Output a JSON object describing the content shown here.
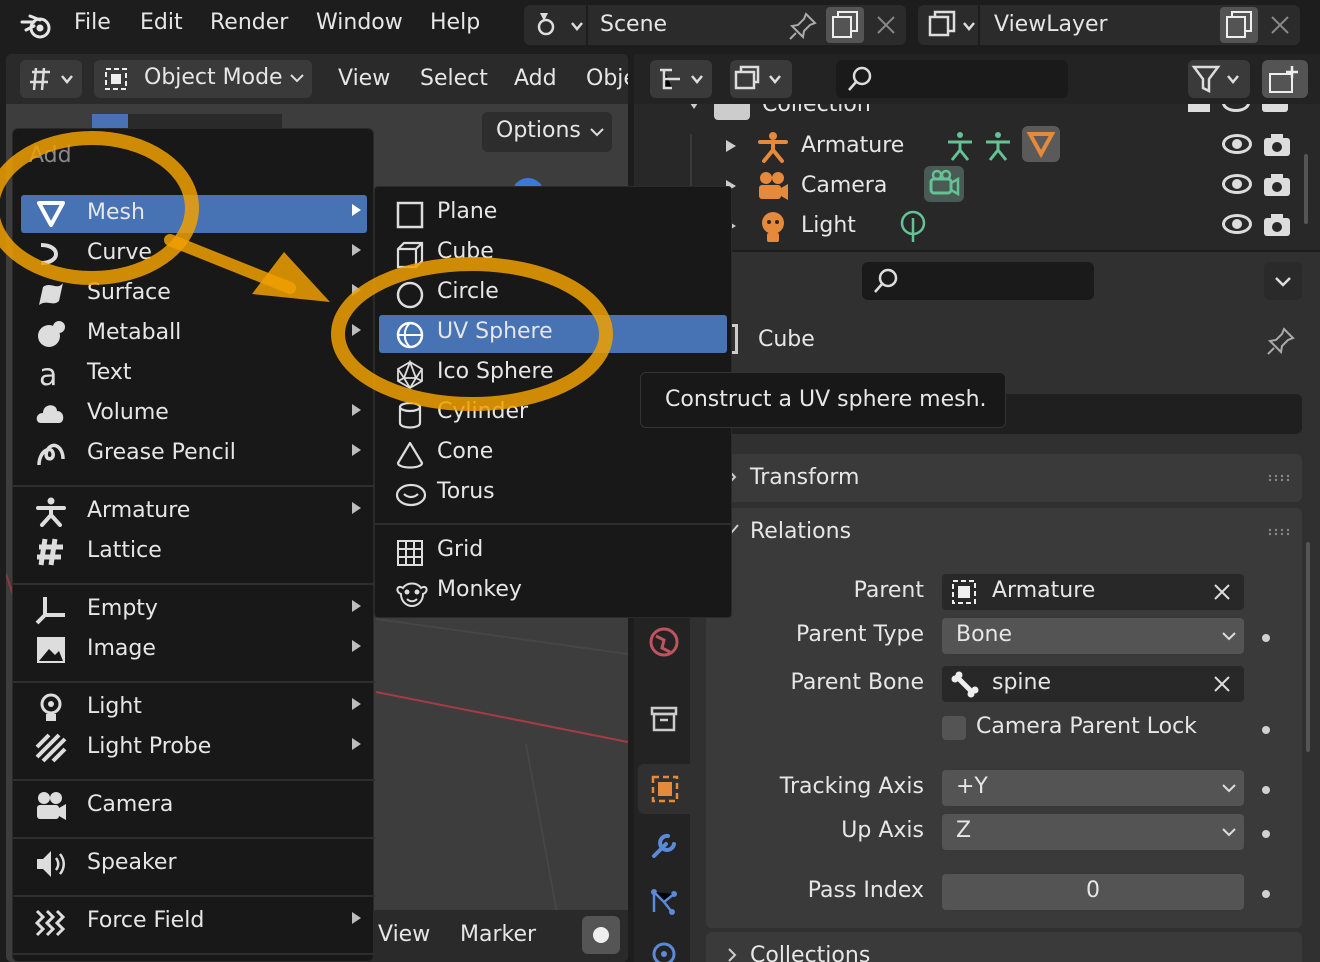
{
  "topbar": {
    "menus": [
      "File",
      "Edit",
      "Render",
      "Window",
      "Help"
    ],
    "scene": "Scene",
    "view_layer": "ViewLayer"
  },
  "viewport": {
    "mode": "Object Mode",
    "menus": [
      "View",
      "Select",
      "Add",
      "Obje"
    ],
    "options_label": "Options",
    "bottom_menus": [
      "View",
      "Marker"
    ]
  },
  "add_menu": {
    "title": "Add",
    "items": [
      {
        "label": "Mesh",
        "icon": "mesh-icon",
        "has_submenu": true,
        "highlighted": true
      },
      {
        "label": "Curve",
        "icon": "curve-icon",
        "has_submenu": true
      },
      {
        "label": "Surface",
        "icon": "surface-icon",
        "has_submenu": true
      },
      {
        "label": "Metaball",
        "icon": "metaball-icon",
        "has_submenu": true
      },
      {
        "label": "Text",
        "icon": "text-icon",
        "has_submenu": false
      },
      {
        "label": "Volume",
        "icon": "volume-icon",
        "has_submenu": true
      },
      {
        "label": "Grease Pencil",
        "icon": "grease-pencil-icon",
        "has_submenu": true
      },
      {
        "label": "Armature",
        "icon": "armature-icon",
        "has_submenu": true
      },
      {
        "label": "Lattice",
        "icon": "lattice-icon",
        "has_submenu": false
      },
      {
        "label": "Empty",
        "icon": "empty-icon",
        "has_submenu": true
      },
      {
        "label": "Image",
        "icon": "image-icon",
        "has_submenu": true
      },
      {
        "label": "Light",
        "icon": "light-icon",
        "has_submenu": true
      },
      {
        "label": "Light Probe",
        "icon": "light-probe-icon",
        "has_submenu": true
      },
      {
        "label": "Camera",
        "icon": "camera-icon",
        "has_submenu": false
      },
      {
        "label": "Speaker",
        "icon": "speaker-icon",
        "has_submenu": false
      },
      {
        "label": "Force Field",
        "icon": "force-field-icon",
        "has_submenu": true
      }
    ]
  },
  "mesh_submenu": {
    "items": [
      {
        "label": "Plane",
        "icon": "plane-icon"
      },
      {
        "label": "Cube",
        "icon": "cube-icon"
      },
      {
        "label": "Circle",
        "icon": "circle-icon"
      },
      {
        "label": "UV Sphere",
        "icon": "uv-sphere-icon",
        "highlighted": true
      },
      {
        "label": "Ico Sphere",
        "icon": "ico-sphere-icon"
      },
      {
        "label": "Cylinder",
        "icon": "cylinder-icon"
      },
      {
        "label": "Cone",
        "icon": "cone-icon"
      },
      {
        "label": "Torus",
        "icon": "torus-icon"
      },
      {
        "label": "Grid",
        "icon": "grid-icon"
      },
      {
        "label": "Monkey",
        "icon": "monkey-icon"
      }
    ]
  },
  "tooltip": "Construct a UV sphere mesh.",
  "outliner": {
    "collection": "Collection",
    "rows": [
      {
        "label": "Armature",
        "icon": "armature-icon"
      },
      {
        "label": "Camera",
        "icon": "camera-icon"
      },
      {
        "label": "Light",
        "icon": "light-icon"
      }
    ]
  },
  "properties": {
    "object_name": "Cube",
    "panels": {
      "transform": "Transform",
      "relations": "Relations",
      "collections": "Collections"
    },
    "fields": {
      "parent_label": "Parent",
      "parent_value": "Armature",
      "parent_type_label": "Parent Type",
      "parent_type_value": "Bone",
      "parent_bone_label": "Parent Bone",
      "parent_bone_value": "spine",
      "camera_parent_lock": "Camera Parent Lock",
      "tracking_axis_label": "Tracking Axis",
      "tracking_axis_value": "+Y",
      "up_axis_label": "Up Axis",
      "up_axis_value": "Z",
      "pass_index_label": "Pass Index",
      "pass_index_value": "0"
    }
  },
  "colors": {
    "highlight": "#4772b3",
    "annotation": "#f0a000",
    "object_orange": "#e5893b",
    "data_green": "#63c394"
  }
}
